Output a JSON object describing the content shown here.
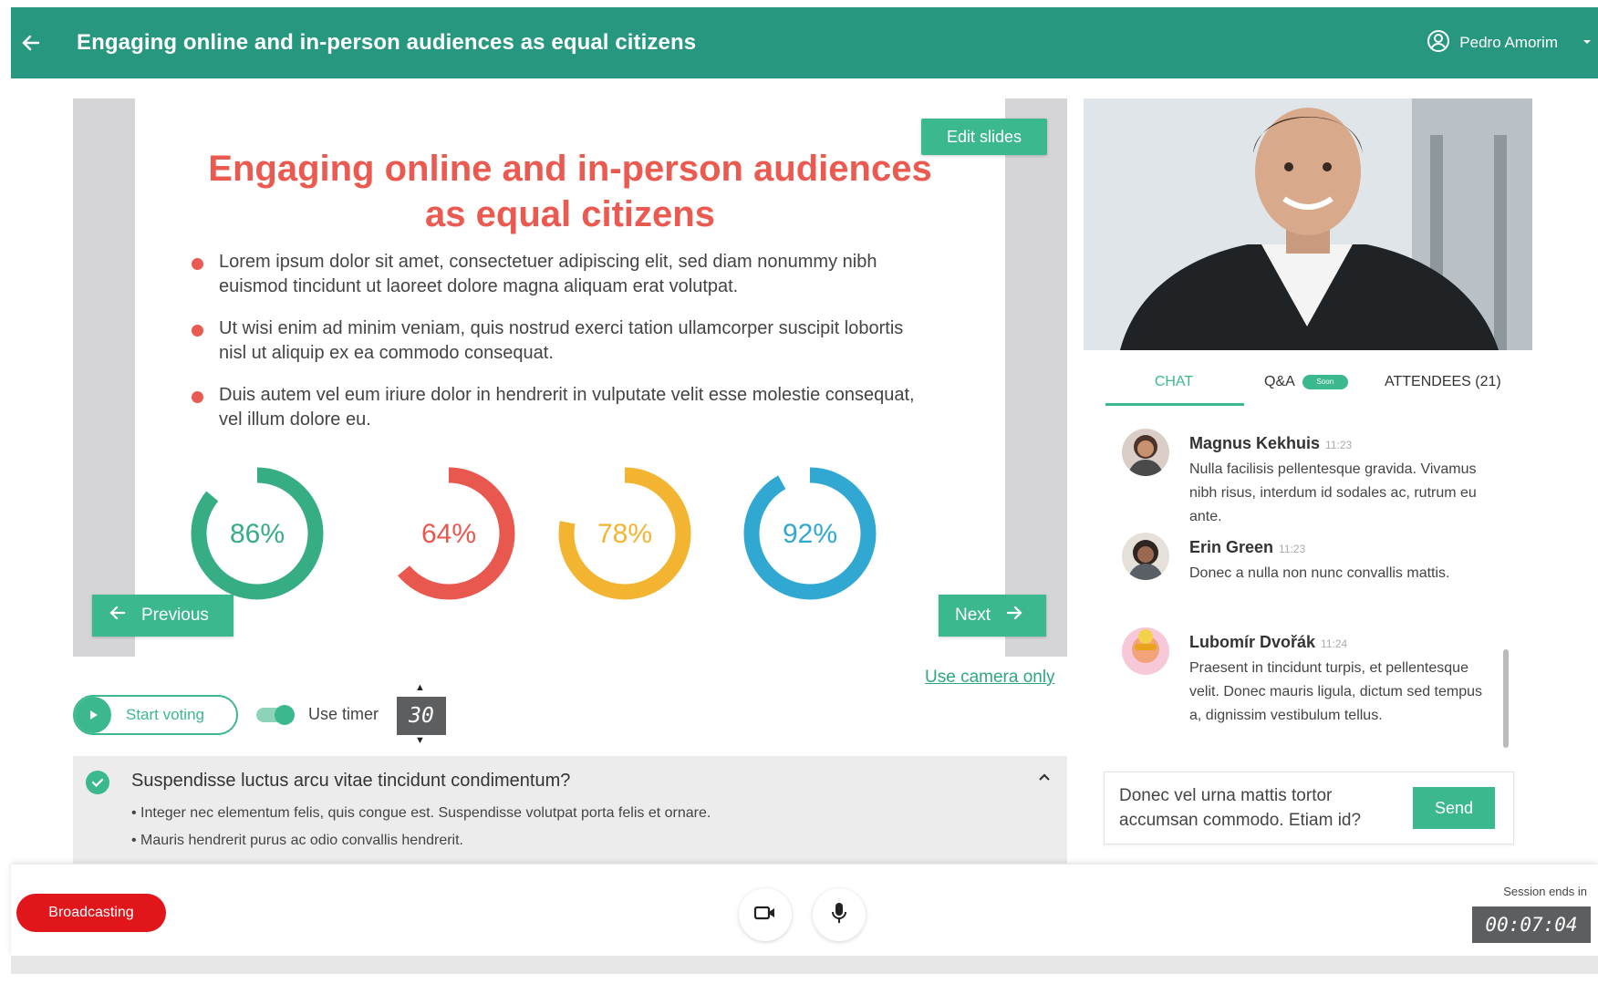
{
  "header": {
    "title": "Engaging online and in-person audiences as equal citizens",
    "user_name": "Pedro Amorim"
  },
  "slide": {
    "edit_label": "Edit slides",
    "title_line1": "Engaging online and in-person audiences",
    "title_line2": "as equal citizens",
    "bullets": [
      "Lorem ipsum dolor sit amet, consectetuer adipiscing elit, sed diam nonummy nibh euismod tincidunt ut laoreet dolore magna aliquam erat volutpat.",
      "Ut wisi enim ad minim veniam, quis nostrud exerci tation ullamcorper suscipit lobortis nisl ut aliquip ex ea commodo consequat.",
      "Duis autem vel eum iriure dolor in hendrerit in vulputate velit esse molestie consequat, vel illum dolore eu."
    ],
    "donuts": [
      {
        "label": "86%",
        "value": 0.86,
        "color": "#36ad82"
      },
      {
        "label": "64%",
        "value": 0.64,
        "color": "#e8584f"
      },
      {
        "label": "78%",
        "value": 0.78,
        "color": "#f2b431"
      },
      {
        "label": "92%",
        "value": 0.92,
        "color": "#30a8d2"
      }
    ],
    "prev_label": "Previous",
    "next_label": "Next",
    "use_camera_label": "Use camera only"
  },
  "voting": {
    "start_label": "Start voting",
    "timer_label": "Use timer",
    "timer_enabled": true,
    "timer_value": "30"
  },
  "question": {
    "title": "Suspendisse luctus arcu vitae tincidunt condimentum?",
    "options": [
      "Integer nec elementum felis, quis congue est. Suspendisse volutpat porta felis et ornare.",
      "Mauris hendrerit purus ac odio convallis hendrerit."
    ]
  },
  "tabs": {
    "chat": "CHAT",
    "qa": "Q&A",
    "qa_badge": "Soon",
    "attendees": "ATTENDEES (21)"
  },
  "chat": {
    "messages": [
      {
        "name": "Magnus Kekhuis",
        "time": "11:23",
        "text": "Nulla facilisis pellentesque gravida. Vivamus nibh risus, interdum id sodales ac, rutrum eu ante."
      },
      {
        "name": "Erin Green",
        "time": "11:23",
        "text": "Donec a nulla non nunc convallis mattis."
      },
      {
        "name": "Lubomír Dvořák",
        "time": "11:24",
        "text": "Praesent in tincidunt turpis, et pellentesque velit. Donec mauris ligula, dictum sed tempus a, dignissim vestibulum tellus."
      }
    ],
    "input_value": "Donec vel urna mattis tortor accumsan commodo. Etiam id?",
    "send_label": "Send"
  },
  "footer": {
    "broadcast_label": "Broadcasting",
    "session_label": "Session ends in",
    "session_time": "00:07:04"
  },
  "colors": {
    "header": "#27987f",
    "accent": "#3cb88e",
    "slide_title": "#ea5a50",
    "broadcast": "#e0161b"
  }
}
